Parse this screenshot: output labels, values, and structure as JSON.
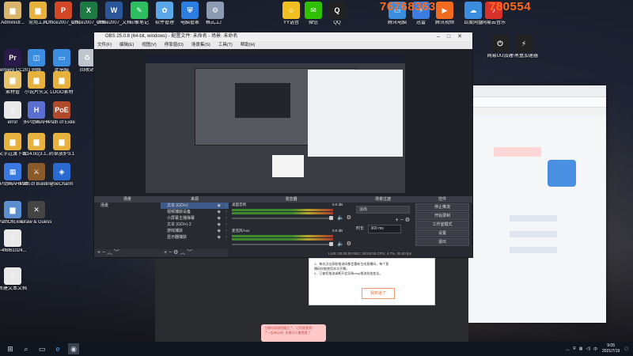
{
  "desktop_icons_left": [
    {
      "label": "Administr...",
      "name": "administrator-icon",
      "color": "#d8b56a",
      "glyph": "▆"
    },
    {
      "label": "常用工具",
      "name": "tools-folder-icon",
      "color": "#e6b13c",
      "glyph": "▆"
    },
    {
      "label": "Office2007_幻灯片PPT",
      "name": "ppt-icon",
      "color": "#d24726",
      "glyph": "P"
    },
    {
      "label": "Office2007_表格",
      "name": "excel-icon",
      "color": "#1d7a43",
      "glyph": "X"
    },
    {
      "label": "Office2007_文档",
      "name": "word-icon",
      "color": "#2b579a",
      "glyph": "W"
    },
    {
      "label": "印象笔记",
      "name": "evernote-icon",
      "color": "#2dbe60",
      "glyph": "✎"
    },
    {
      "label": "软件管理",
      "name": "software-manager-icon",
      "color": "#5aa6e8",
      "glyph": "✿"
    },
    {
      "label": "电脑管家",
      "name": "pc-manager-icon",
      "color": "#2b7de0",
      "glyph": "⛨"
    },
    {
      "label": "格式工厂",
      "name": "format-factory-icon",
      "color": "#8c9bb2",
      "glyph": "⚙"
    }
  ],
  "desktop_icons_col1": [
    {
      "label": "Premiere CC2019",
      "name": "premiere-icon",
      "color": "#2a1a4a",
      "glyph": "Pr"
    },
    {
      "label": "素材管",
      "name": "materials-icon",
      "color": "#e8c36a",
      "glyph": "▆"
    },
    {
      "label": "error",
      "name": "error-file-icon",
      "color": "#e9e9e9",
      "glyph": "▯"
    },
    {
      "label": "文字过渡下载",
      "name": "text-download-icon",
      "color": "#e6b13c",
      "glyph": "▆"
    },
    {
      "label": "多P动画AHK20.19...",
      "name": "ahk-animation-icon",
      "color": "#3a7ae0",
      "glyph": "▦"
    },
    {
      "label": "PathOfExile...",
      "name": "pathofexile-folder-icon",
      "color": "#5b8fd0",
      "glyph": "▆"
    },
    {
      "label": "~4f6f61024...",
      "name": "temp-file-icon",
      "color": "#e9e9e9",
      "glyph": "▯"
    },
    {
      "label": "新建文本文档",
      "name": "new-text-doc-icon",
      "color": "#e9e9e9",
      "glyph": "▯"
    }
  ],
  "desktop_icons_col2": [
    {
      "label": "网络",
      "name": "network-icon",
      "color": "#3b8de0",
      "glyph": "◫"
    },
    {
      "label": "小说片头文",
      "name": "novel-intro-icon",
      "color": "#e6b13c",
      "glyph": "▆"
    },
    {
      "label": "多P动画AHK",
      "name": "ahk-icon",
      "color": "#5b6fd0",
      "glyph": "H"
    },
    {
      "label": "3.14.0c(3.1...",
      "name": "version-file-icon",
      "color": "#e6b13c",
      "glyph": "▆"
    },
    {
      "label": "Path of Building",
      "name": "path-of-building-icon",
      "color": "#8a5a2a",
      "glyph": "⚔"
    },
    {
      "label": "Draw & Guess",
      "name": "draw-guess-icon",
      "color": "#444",
      "glyph": "✕"
    }
  ],
  "desktop_icons_col3": [
    {
      "label": "此电脑",
      "name": "this-pc-icon",
      "color": "#3b8de0",
      "glyph": "▭"
    },
    {
      "label": "LOGO素材",
      "name": "logo-materials-icon",
      "color": "#e6b13c",
      "glyph": "▆"
    },
    {
      "label": "Path of Exile",
      "name": "path-of-exile-icon",
      "color": "#b04a2a",
      "glyph": "PoE"
    },
    {
      "label": "药草放炉3.1",
      "name": "herb-file-icon",
      "color": "#e6b13c",
      "glyph": "▆"
    },
    {
      "label": "PoeCharm",
      "name": "poecharm-icon",
      "color": "#2a6ad0",
      "glyph": "◈"
    }
  ],
  "desktop_icons_col4": [
    {
      "label": "回收站",
      "name": "recycle-bin-icon",
      "color": "#c0c4cc",
      "glyph": "♻"
    }
  ],
  "desktop_icons_top_right": [
    {
      "label": "YY语音",
      "name": "yy-icon",
      "color": "#f0c020",
      "glyph": "☺"
    },
    {
      "label": "微信",
      "name": "wechat-icon",
      "color": "#2dc100",
      "glyph": "✉"
    },
    {
      "label": "QQ",
      "name": "qq-icon",
      "color": "#222",
      "glyph": "Q"
    },
    {
      "label": "腾讯电脑",
      "name": "tencent-pc-icon",
      "color": "#3b8de0",
      "glyph": "▭"
    },
    {
      "label": "迅雷",
      "name": "thunder-icon",
      "color": "#3b7de0",
      "glyph": "⚡"
    },
    {
      "label": "腾讯视频",
      "name": "tencent-video-icon",
      "color": "#f06a20",
      "glyph": "▶"
    },
    {
      "label": "百度网盘",
      "name": "baidu-pan-icon",
      "color": "#3b8de0",
      "glyph": "☁"
    },
    {
      "label": "网易云音乐",
      "name": "netease-icon",
      "color": "#d8302a",
      "glyph": "♪"
    },
    {
      "label": "网易UU加速",
      "name": "uu-icon",
      "color": "#222",
      "glyph": "⏻"
    },
    {
      "label": "小黑盒加速器",
      "name": "xiaoheihe-icon",
      "color": "#222",
      "glyph": "⚡"
    }
  ],
  "overlay_number_left": "767683637",
  "overlay_number_right": "780554",
  "obs": {
    "title": "OBS 25.0.8 (64-bit, windows) - 配置文件: 未命名 - 场景: 未命名",
    "menu": [
      "文件(F)",
      "编辑(E)",
      "视图(V)",
      "停靠窗(D)",
      "场景集(S)",
      "工具(T)",
      "帮助(H)"
    ],
    "panels": {
      "scenes": {
        "header": "场景",
        "items": [
          "场景"
        ]
      },
      "sources": {
        "header": "来源",
        "items": [
          "文本 (GDI+)",
          "视频捕获设备",
          "小屏幕主播弹幕",
          "文本 (GDI+) 2",
          "游戏捕获",
          "显示器捕获"
        ]
      },
      "mixer": {
        "header": "混音器",
        "tracks": [
          {
            "name": "桌面音频",
            "db": "0.0 dB"
          },
          {
            "name": "麦克风/Aux",
            "db": "0.0 dB"
          }
        ]
      },
      "transitions": {
        "header": "场景过渡",
        "type": "淡出",
        "duration_label": "时长",
        "duration": "300 ms"
      },
      "controls": {
        "header": "控件",
        "buttons": [
          "停止推流",
          "开始录制",
          "工作室模式",
          "设置",
          "退出"
        ]
      }
    },
    "status": "LIVE: 00:28:00  REC: 00:00:00  CPU: 4.7%, 30.00 fps"
  },
  "dialog": {
    "text_line1": "1、每次点击获取推流码都会重新生成直播码，每个直",
    "text_line2": "播码仅能使用本次开播。",
    "text_line3": "2、已被拒推流或断开会导致rtmp推流失效变化。",
    "button": "我知道了"
  },
  "toast": {
    "line1": "主播你刚刚提醒过了，记得查看哦！",
    "line2": "了一起来玩吧~直播间开播提醒了"
  },
  "taskbar": {
    "time": "9:05",
    "date": "2021/7/19",
    "lang": "中",
    "apps": [
      "search",
      "taskview",
      "edge",
      "obs"
    ]
  }
}
